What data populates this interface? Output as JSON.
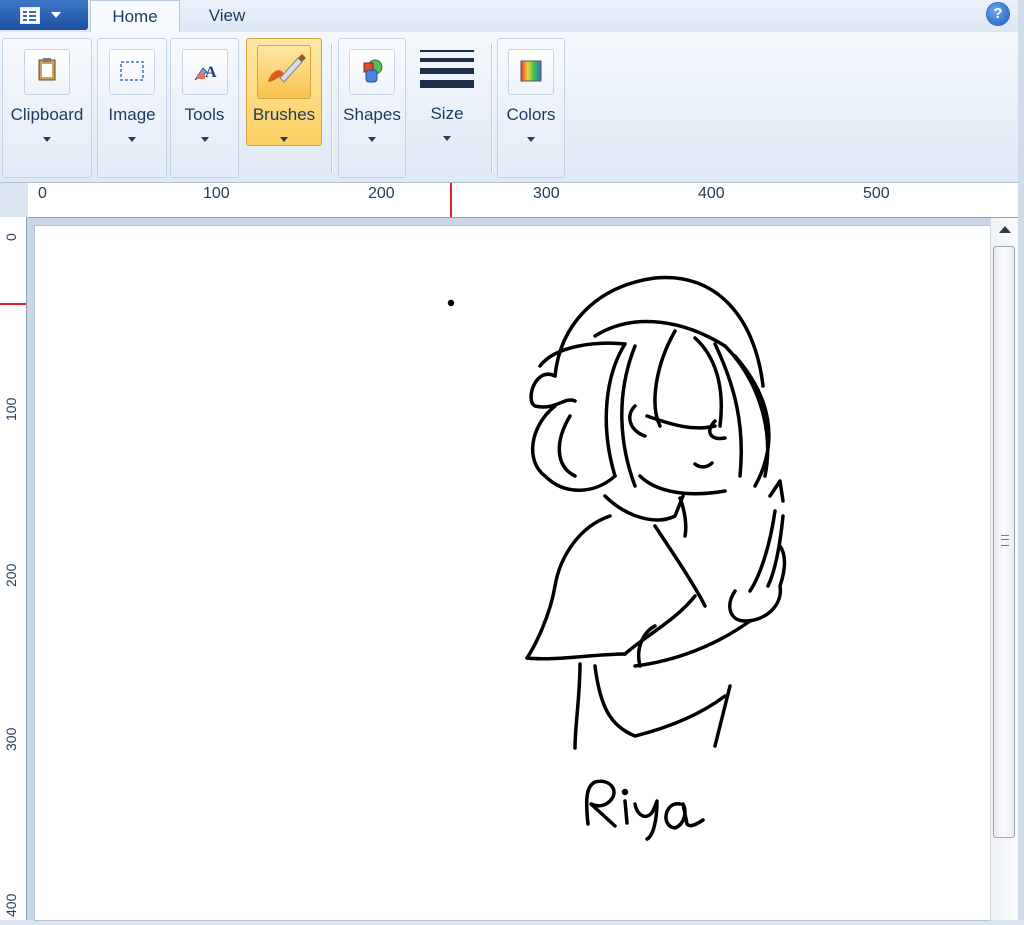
{
  "tabs": {
    "home": "Home",
    "view": "View"
  },
  "help_symbol": "?",
  "ribbon": {
    "clipboard": "Clipboard",
    "image": "Image",
    "tools": "Tools",
    "brushes": "Brushes",
    "shapes": "Shapes",
    "size": "Size",
    "colors": "Colors"
  },
  "ruler": {
    "horizontal": [
      "0",
      "100",
      "200",
      "300",
      "400",
      "500"
    ],
    "vertical": [
      "0",
      "100",
      "200",
      "300",
      "400"
    ]
  },
  "drawing": {
    "signature": "Riya"
  },
  "colors": {
    "accent": "#1d4f9f",
    "selected": "#fbcf62",
    "ruler_marker": "#e2202b"
  }
}
